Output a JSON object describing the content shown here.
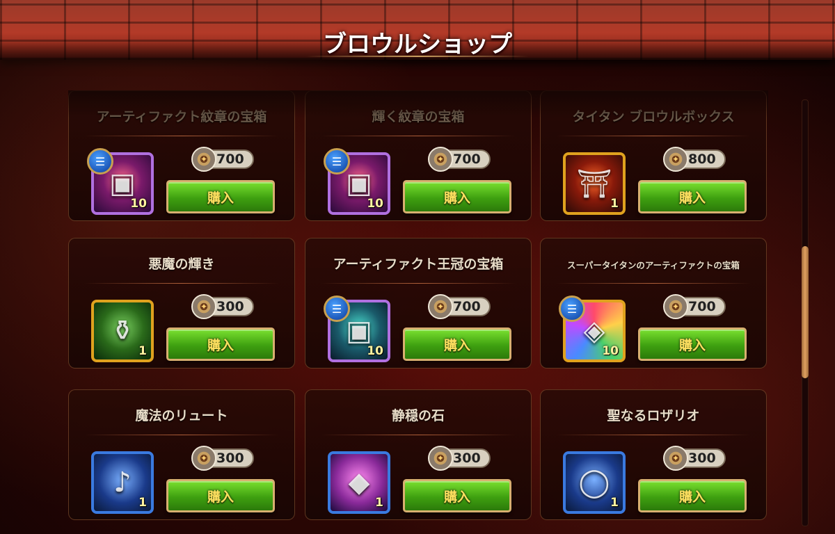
{
  "shop": {
    "title": "ブロウルショップ",
    "buy_label": "購入",
    "cards": [
      {
        "title": "アーティファクト紋章の宝箱",
        "price": "700",
        "qty": "10",
        "info": true
      },
      {
        "title": "輝く紋章の宝箱",
        "price": "700",
        "qty": "10",
        "info": true
      },
      {
        "title": "タイタン ブロウルボックス",
        "price": "800",
        "qty": "1",
        "info": false
      },
      {
        "title": "悪魔の輝き",
        "price": "300",
        "qty": "1",
        "info": false
      },
      {
        "title": "アーティファクト王冠の宝箱",
        "price": "700",
        "qty": "10",
        "info": true
      },
      {
        "title": "スーパータイタンのアーティファクトの宝箱",
        "price": "700",
        "qty": "10",
        "info": true
      },
      {
        "title": "魔法のリュート",
        "price": "300",
        "qty": "1",
        "info": false
      },
      {
        "title": "静穏の石",
        "price": "300",
        "qty": "1",
        "info": false
      },
      {
        "title": "聖なるロザリオ",
        "price": "300",
        "qty": "1",
        "info": false
      }
    ]
  },
  "icons": {
    "info": "list-icon",
    "currency": "brawl-coin-icon"
  }
}
